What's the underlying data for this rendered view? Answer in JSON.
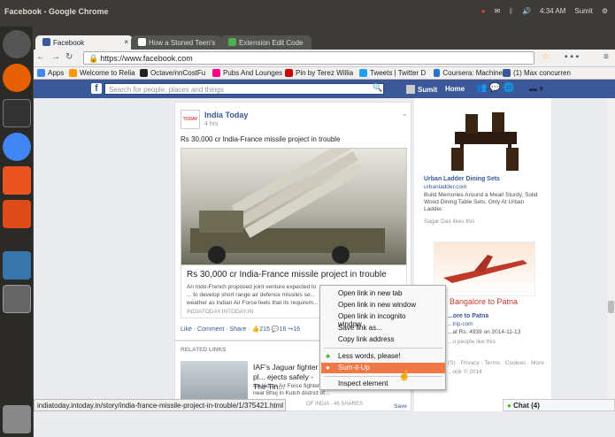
{
  "window": {
    "title": "Facebook - Google Chrome"
  },
  "system_tray": {
    "time": "4:34 AM",
    "user": "Sumit"
  },
  "tabs": [
    {
      "label": "Facebook"
    },
    {
      "label": "How a Stoned Teen's"
    },
    {
      "label": "Extension Edit Code"
    }
  ],
  "address": {
    "url": "https://www.facebook.com"
  },
  "bookmarks": [
    "Apps",
    "Welcome to Relia",
    "Octave/nnCostFu",
    "Pubs And Lounges",
    "Pin by Terez Willia",
    "Tweets | Twitter D",
    "Coursera: Machine",
    "(1) Max concurren"
  ],
  "fb": {
    "search_placeholder": "Search for people, places and things",
    "user": "Sumit",
    "home": "Home"
  },
  "post": {
    "source": "India Today",
    "time": "4 hrs",
    "text": "Rs 30,000 cr India-France missile project in trouble",
    "link_title": "Rs 30,000 cr India-France missile project in trouble",
    "link_desc": "An Indo-French proposed joint venture expected to ... to develop short range air defence missiles se... weather as Indian Air Force feels that its requirem...",
    "link_domain": "INDIATODAY.INTODAY.IN",
    "actions": "Like · Comment · Share ·",
    "likes": "215",
    "comments": "16",
    "shares": "16"
  },
  "related": {
    "header": "RELATED LINKS",
    "title": "IAF's Jaguar fighter pl... ejects safely - The Tin...",
    "desc": "An Indian Air Force fighter... training mission crashed near Bhuj in Kutch district of...",
    "meta": "OF INDIA · 45 SHARES",
    "save": "Save"
  },
  "ads": {
    "ad1_title": "Urban Ladder Dining Sets",
    "ad1_url": "urbanladder.com",
    "ad1_desc": "Build Memories Around a Meal! Sturdy, Solid Wood Dining Table Sets, Only At Urban Ladder.",
    "ad1_social": "Sagar Das likes this",
    "ad2_banner": "Bangalore to Patna",
    "ad2_title": "...ore to Patna",
    "ad2_url": "...trip.com",
    "ad2_desc": "...at Rs. 4939 on 2014-11-13",
    "ad2_social": "...o people like this",
    "footer": "(S) · Privacy · Terms · Cookies · More ·",
    "copyright": "...ook © 2014"
  },
  "context_menu": [
    "Open link in new tab",
    "Open link in new window",
    "Open link in incognito window",
    "Save link as...",
    "Copy link address",
    "Less words, please!",
    "Sum-it-Up",
    "Inspect element"
  ],
  "status_url": "indiatoday.intoday.in/story/india-france-missile-project-in-trouble/1/375421.html",
  "chat": "Chat (4)"
}
